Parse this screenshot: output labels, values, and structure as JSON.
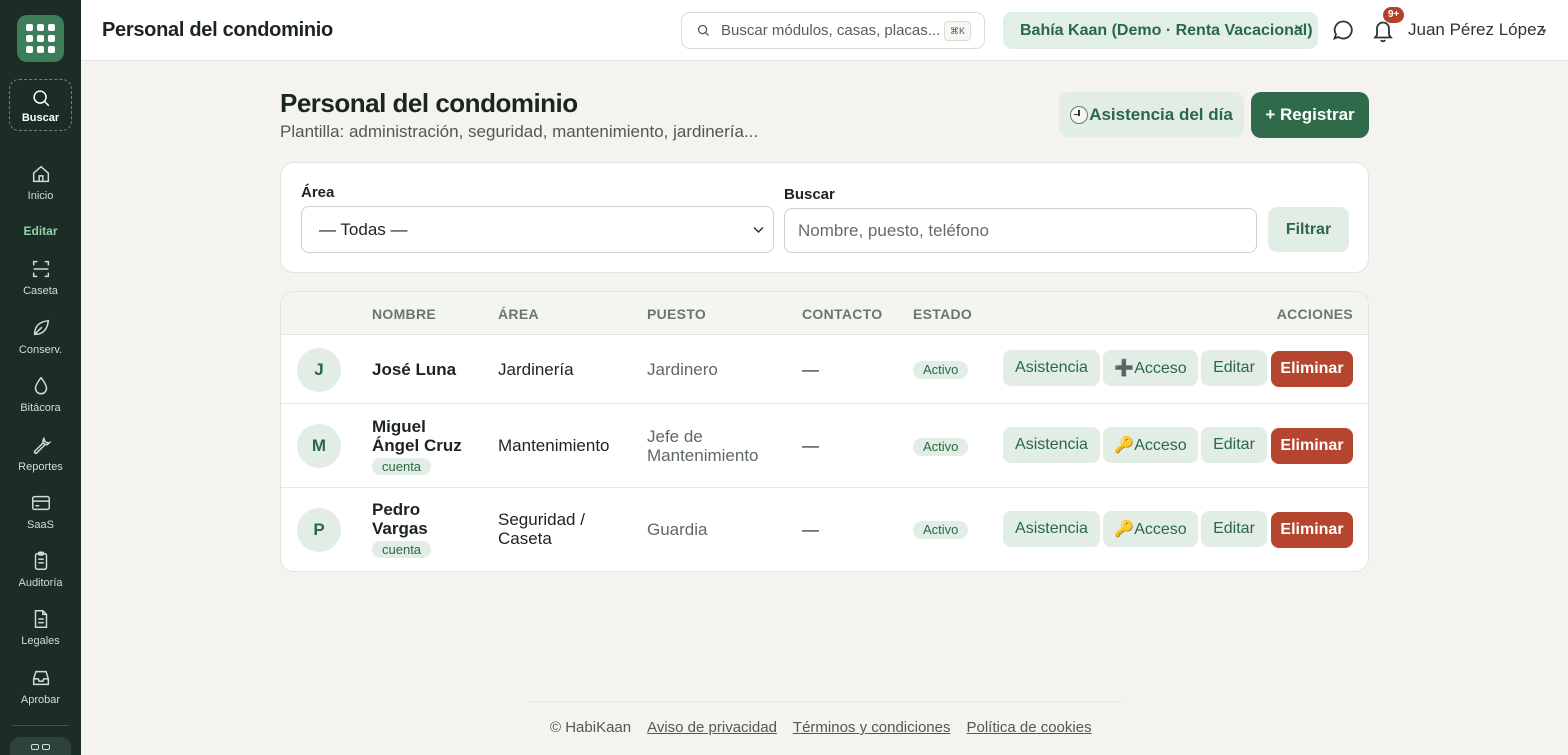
{
  "app": {
    "title": "Personal del condominio"
  },
  "search": {
    "placeholder": "Buscar módulos, casas, placas...",
    "shortcut": "⌘K"
  },
  "org": {
    "selected": "Bahía Kaan (Demo · Renta Vacacional)"
  },
  "notifications": {
    "count": "9+"
  },
  "user": {
    "name": "Juan Pérez López"
  },
  "sidebar": {
    "search_label": "Buscar",
    "items": [
      {
        "label": "Inicio",
        "icon": "home-icon"
      },
      {
        "label": "Caseta",
        "icon": "scan-icon"
      },
      {
        "label": "Conserv.",
        "icon": "leaf-icon"
      },
      {
        "label": "Bitácora",
        "icon": "drop-icon"
      },
      {
        "label": "Reportes",
        "icon": "wrench-icon"
      },
      {
        "label": "SaaS",
        "icon": "card-icon"
      },
      {
        "label": "Auditoría",
        "icon": "clipboard-icon"
      },
      {
        "label": "Legales",
        "icon": "document-icon"
      },
      {
        "label": "Aprobar",
        "icon": "inbox-icon"
      }
    ],
    "section_label": "Editar"
  },
  "page": {
    "title": "Personal del condominio",
    "subtitle": "Plantilla: administración, seguridad, mantenimiento, jardinería...",
    "attendance_button": "Asistencia del día",
    "register_button": "+ Registrar"
  },
  "filters": {
    "area_label": "Área",
    "area_selected": "— Todas —",
    "search_label": "Buscar",
    "search_placeholder": "Nombre, puesto, teléfono",
    "filter_button": "Filtrar"
  },
  "table": {
    "headers": {
      "name": "NOMBRE",
      "area": "ÁREA",
      "position": "PUESTO",
      "contact": "CONTACTO",
      "status": "ESTADO",
      "actions": "ACCIONES"
    },
    "rows": [
      {
        "initial": "J",
        "name": "José Luna",
        "tag": "",
        "area": "Jardinería",
        "position": "Jardinero",
        "contact": "—",
        "status": "Activo",
        "access": "➕Acceso"
      },
      {
        "initial": "M",
        "name": "Miguel Ángel Cruz",
        "tag": "cuenta",
        "area": "Mantenimiento",
        "position": "Jefe de Mantenimiento",
        "contact": "—",
        "status": "Activo",
        "access": "🔑Acceso"
      },
      {
        "initial": "P",
        "name": "Pedro Vargas",
        "tag": "cuenta",
        "area": "Seguridad / Caseta",
        "position": "Guardia",
        "contact": "—",
        "status": "Activo",
        "access": "🔑Acceso"
      }
    ],
    "actions": {
      "attendance": "Asistencia",
      "edit": "Editar",
      "delete": "Eliminar"
    }
  },
  "footer": {
    "copyright": "© HabiKaan",
    "privacy": "Aviso de privacidad",
    "terms": "Términos y condiciones",
    "cookies": "Política de cookies"
  }
}
